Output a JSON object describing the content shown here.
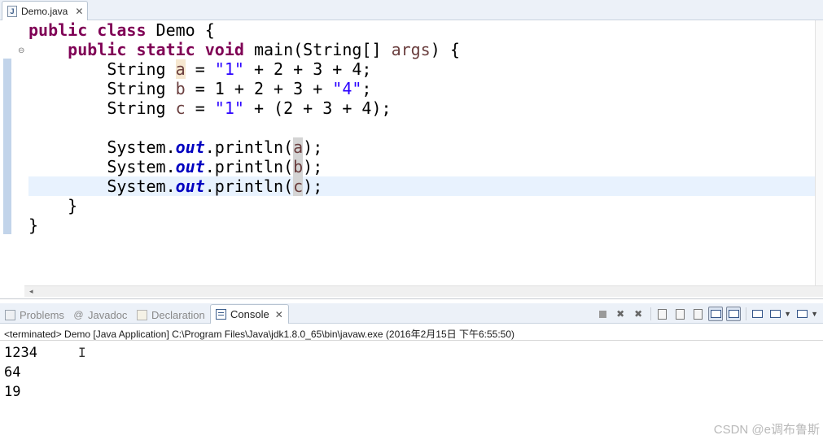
{
  "editor": {
    "tab": {
      "icon": "java-file-icon",
      "label": "Demo.java",
      "close": "✕"
    },
    "code_lines": [
      {
        "indent": 0,
        "tokens": [
          {
            "t": "public",
            "c": "kw"
          },
          {
            "t": " "
          },
          {
            "t": "class",
            "c": "kw"
          },
          {
            "t": " Demo {"
          }
        ]
      },
      {
        "indent": 4,
        "tokens": [
          {
            "t": "public",
            "c": "kw"
          },
          {
            "t": " "
          },
          {
            "t": "static",
            "c": "kw"
          },
          {
            "t": " "
          },
          {
            "t": "void",
            "c": "kw"
          },
          {
            "t": " main(String[] "
          },
          {
            "t": "args",
            "c": "var"
          },
          {
            "t": ") {"
          }
        ]
      },
      {
        "indent": 8,
        "tokens": [
          {
            "t": "String "
          },
          {
            "t": "a",
            "c": "var occ-a"
          },
          {
            "t": " = "
          },
          {
            "t": "\"1\"",
            "c": "str"
          },
          {
            "t": " + 2 + 3 + 4;"
          }
        ]
      },
      {
        "indent": 8,
        "tokens": [
          {
            "t": "String "
          },
          {
            "t": "b",
            "c": "var"
          },
          {
            "t": " = 1 + 2 + 3 + "
          },
          {
            "t": "\"4\"",
            "c": "str"
          },
          {
            "t": ";"
          }
        ]
      },
      {
        "indent": 8,
        "tokens": [
          {
            "t": "String "
          },
          {
            "t": "c",
            "c": "var"
          },
          {
            "t": " = "
          },
          {
            "t": "\"1\"",
            "c": "str"
          },
          {
            "t": " + (2 + 3 + 4);"
          }
        ]
      },
      {
        "indent": 0,
        "tokens": []
      },
      {
        "indent": 8,
        "tokens": [
          {
            "t": "System."
          },
          {
            "t": "out",
            "c": "field"
          },
          {
            "t": ".println("
          },
          {
            "t": "a",
            "c": "var hl"
          },
          {
            "t": ");"
          }
        ]
      },
      {
        "indent": 8,
        "tokens": [
          {
            "t": "System."
          },
          {
            "t": "out",
            "c": "field"
          },
          {
            "t": ".println("
          },
          {
            "t": "b",
            "c": "var hl"
          },
          {
            "t": ");"
          }
        ]
      },
      {
        "indent": 8,
        "tokens": [
          {
            "t": "System."
          },
          {
            "t": "out",
            "c": "field"
          },
          {
            "t": ".println("
          },
          {
            "t": "c",
            "c": "var hl"
          },
          {
            "t": ");"
          }
        ]
      },
      {
        "indent": 4,
        "tokens": [
          {
            "t": "}"
          }
        ]
      },
      {
        "indent": 0,
        "tokens": [
          {
            "t": "}"
          }
        ]
      }
    ],
    "scroll_left_arrow": "◂"
  },
  "views": {
    "tabs": [
      {
        "icon": "problems-icon",
        "label": "Problems",
        "active": false
      },
      {
        "icon": "javadoc-icon",
        "label": "Javadoc",
        "active": false
      },
      {
        "icon": "declaration-icon",
        "label": "Declaration",
        "active": false
      },
      {
        "icon": "console-icon",
        "label": "Console",
        "active": true,
        "close": "✕"
      }
    ],
    "console": {
      "status": "<terminated> Demo [Java Application] C:\\Program Files\\Java\\jdk1.8.0_65\\bin\\javaw.exe (2016年2月15日 下午6:55:50)",
      "output": [
        "1234",
        "64",
        "19"
      ],
      "cursor": "I"
    },
    "toolbar_icons": [
      "terminate-icon",
      "remove-launch-icon",
      "remove-all-terminated-icon",
      "clear-console-icon",
      "scroll-lock-icon",
      "word-wrap-icon",
      "show-on-stdout-icon",
      "show-on-stderr-icon",
      "pin-console-icon",
      "display-console-icon",
      "open-console-icon"
    ]
  },
  "watermark": "CSDN @e调布鲁斯"
}
